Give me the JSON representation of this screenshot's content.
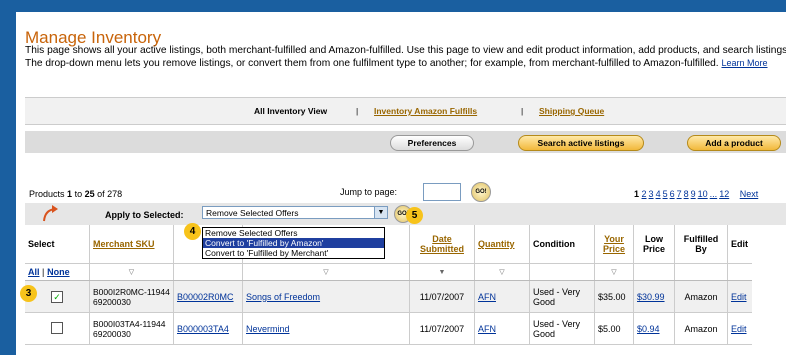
{
  "page": {
    "title": "Manage Inventory",
    "description": "This page shows all your active listings, both merchant-fulfilled and Amazon-fulfilled. Use this page to view and edit product information, add products, and search listings. The drop-down menu lets you remove listings, or convert them from one fulfilment type to another; for example, from merchant-fulfilled to Amazon-fulfilled.",
    "learn_more": "Learn More"
  },
  "views": {
    "current": "All Inventory View",
    "sep": "|",
    "amazon_fulfills": "Inventory Amazon Fulfills",
    "shipping_queue": "Shipping Queue"
  },
  "buttons": {
    "preferences": "Preferences",
    "search": "Search active listings",
    "add": "Add a product"
  },
  "paging": {
    "products_prefix": "Products",
    "from": "1",
    "to_word": "to",
    "to": "25",
    "of_word": "of",
    "total": "278",
    "jump_label": "Jump to page:",
    "go": "GO!",
    "current": "1",
    "pages": [
      "2",
      "3",
      "4",
      "5",
      "6",
      "7",
      "8",
      "9",
      "10",
      "...",
      "12"
    ],
    "next": "Next"
  },
  "apply": {
    "label": "Apply to Selected:",
    "selected": "Remove Selected Offers",
    "go": "GO!",
    "options": [
      "Remove Selected Offers",
      "Convert to 'Fulfilled by Amazon'",
      "Convert to 'Fulfilled by Merchant'"
    ]
  },
  "badges": {
    "step3": "3",
    "step4": "4",
    "step5": "5"
  },
  "table": {
    "headers": {
      "select": "Select",
      "sku": "Merchant SKU",
      "date": "Date Submitted",
      "qty": "Quantity",
      "cond": "Condition",
      "price": "Your Price",
      "low": "Low Price",
      "fulfilled": "Fulfilled By",
      "edit": "Edit"
    },
    "all": "All",
    "sep": "|",
    "none": "None",
    "rows": [
      {
        "checked": "✓",
        "sku": "B000I2R0MC-1194469200030",
        "asin": "B00002R0MC",
        "title": "Songs of Freedom",
        "date": "11/07/2007",
        "qty": "AFN",
        "cond": "Used - Very Good",
        "price": "$35.00",
        "low": "$30.99",
        "by": "Amazon",
        "edit": "Edit"
      },
      {
        "checked": "",
        "sku": "B000I03TA4-1194469200030",
        "asin": "B000003TA4",
        "title": "Nevermind",
        "date": "11/07/2007",
        "qty": "AFN",
        "cond": "Used - Very Good",
        "price": "$5.00",
        "low": "$0.94",
        "by": "Amazon",
        "edit": "Edit"
      }
    ]
  },
  "colors": {
    "accent": "#c8640a",
    "link": "#003399",
    "frame": "#1a5fa0",
    "badge": "#f7c31b"
  }
}
